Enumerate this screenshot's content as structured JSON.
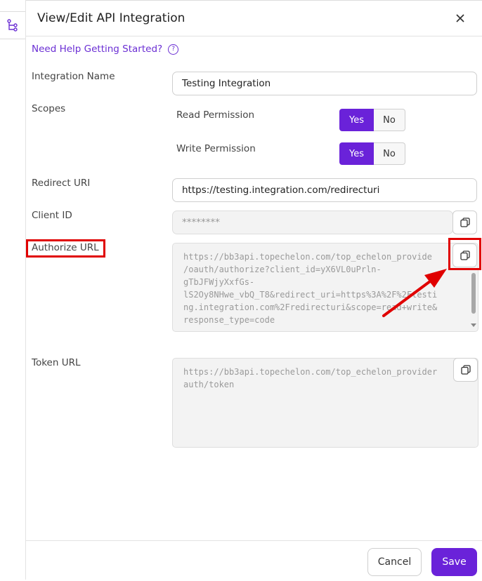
{
  "modal": {
    "title": "View/Edit API Integration",
    "help_link": "Need Help Getting Started?",
    "help_icon": "question-circle-icon"
  },
  "fields": {
    "integration_name_label": "Integration Name",
    "integration_name_value": "Testing Integration",
    "scopes_label": "Scopes",
    "read_permission_label": "Read Permission",
    "write_permission_label": "Write Permission",
    "yes_label": "Yes",
    "no_label": "No",
    "redirect_uri_label": "Redirect URI",
    "redirect_uri_value": "https://testing.integration.com/redirecturi",
    "client_id_label": "Client ID",
    "client_id_value": "********",
    "authorize_url_label": "Authorize URL",
    "authorize_url_lines": "https://bb3api.topechelon.com/top_echelon_provide\n/oauth/authorize?client_id=yX6VL0uPrln-\ngTbJFWjyXxfGs-\nlS2Oy8NHwe_vbQ_T8&redirect_uri=https%3A%2F%2Ftesti\nng.integration.com%2Fredirecturi&scope=read+write&\nresponse_type=code",
    "token_url_label": "Token URL",
    "token_url_lines": "https://bb3api.topechelon.com/top_echelon_provider\nauth/token"
  },
  "footer": {
    "cancel_label": "Cancel",
    "save_label": "Save"
  },
  "colors": {
    "accent": "#6a22d9",
    "annotation": "#e00000"
  }
}
